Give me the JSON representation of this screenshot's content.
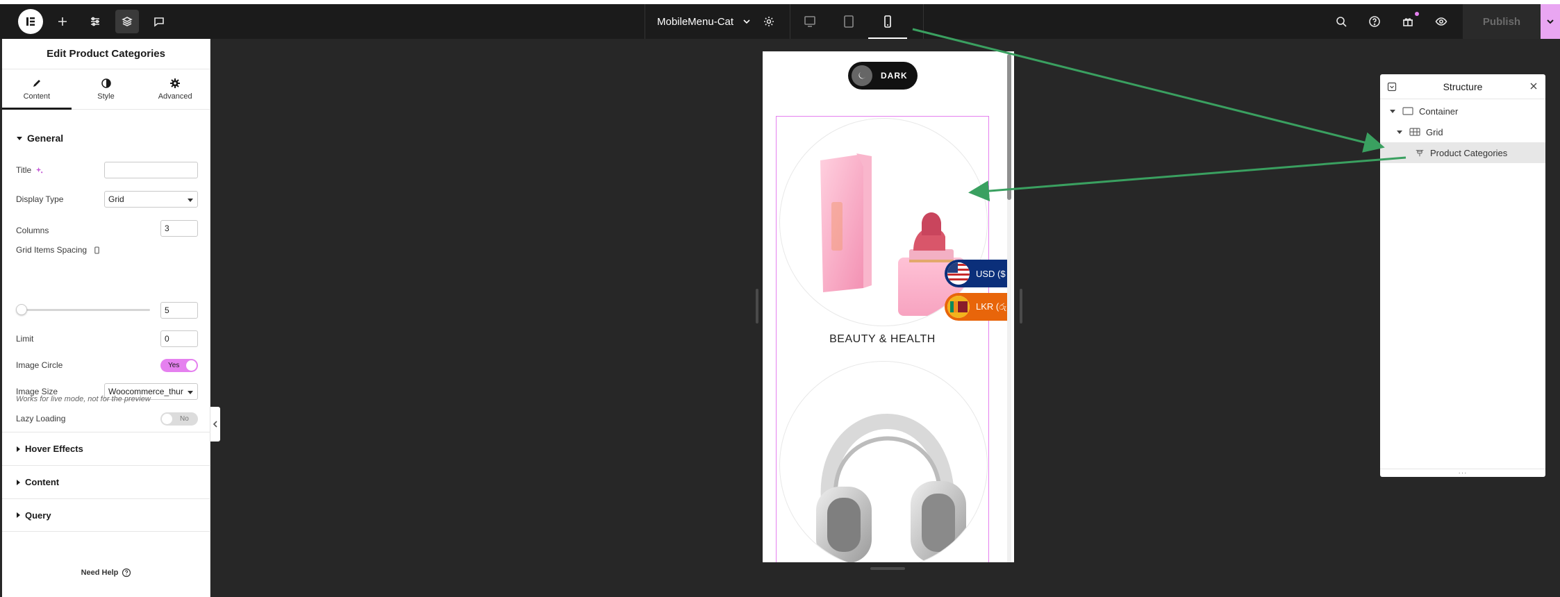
{
  "topbar": {
    "document_title": "MobileMenu-Cat",
    "publish_label": "Publish"
  },
  "panel": {
    "title": "Edit Product Categories",
    "tabs": [
      {
        "label": "Content",
        "icon": "pencil-icon"
      },
      {
        "label": "Style",
        "icon": "half-circle-icon"
      },
      {
        "label": "Advanced",
        "icon": "gear-icon"
      }
    ],
    "general": {
      "heading": "General",
      "title_label": "Title",
      "title_value": "",
      "display_type_label": "Display Type",
      "display_type_value": "Grid",
      "columns_label": "Columns",
      "columns_value": "3",
      "spacing_label": "Grid Items Spacing",
      "spacing_value": "5",
      "limit_label": "Limit",
      "limit_value": "0",
      "image_circle_label": "Image Circle",
      "image_circle_value": "Yes",
      "image_size_label": "Image Size",
      "image_size_value": "Woocommerce_thur",
      "lazy_label": "Lazy Loading",
      "lazy_value": "No",
      "note": "Works for live mode, not for the preview"
    },
    "sections": [
      "Hover Effects",
      "Content",
      "Query"
    ],
    "need_help": "Need Help"
  },
  "preview": {
    "dark_label": "DARK",
    "category_1": "BEAUTY & HEALTH",
    "currency_usd": "USD ($",
    "currency_lkr": "LKR (රු"
  },
  "structure": {
    "title": "Structure",
    "items": [
      {
        "label": "Container"
      },
      {
        "label": "Grid"
      },
      {
        "label": "Product Categories"
      }
    ]
  },
  "colors": {
    "accent": "#e580ef",
    "arrow": "#3aa060",
    "usd_badge": "#0b2f7a",
    "lkr_badge": "#e8650a"
  }
}
